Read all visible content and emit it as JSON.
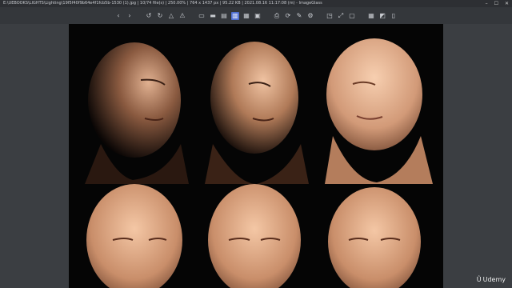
{
  "window": {
    "title": "E:\\UEBOOKS\\LIGHTS\\Lighting\\19f5f40f9b64e4f1fcb5b-1530 (1).jpg | 10/74 file(s) | 250.00% | 764 x 1437 px | 95.22 KB | 2021.08.16 11:17:08 (m) - ImageGlass"
  },
  "toolbar": {
    "buttons": [
      {
        "name": "back-icon",
        "glyph": "‹"
      },
      {
        "name": "forward-icon",
        "glyph": "›"
      },
      {
        "sep": true
      },
      {
        "name": "rotate-left-icon",
        "glyph": "↺"
      },
      {
        "name": "rotate-right-icon",
        "glyph": "↻"
      },
      {
        "name": "flip-icon",
        "glyph": "△"
      },
      {
        "name": "delete-icon",
        "glyph": "⚠"
      },
      {
        "sep": true
      },
      {
        "name": "auto-zoom-icon",
        "glyph": "▭"
      },
      {
        "name": "lock-zoom-icon",
        "glyph": "▬"
      },
      {
        "name": "scale-width-icon",
        "glyph": "▤"
      },
      {
        "name": "scale-height-icon",
        "glyph": "▥",
        "active": true
      },
      {
        "name": "scale-fill-icon",
        "glyph": "▦"
      },
      {
        "name": "scale-fit-icon",
        "glyph": "▣"
      },
      {
        "sep": true
      },
      {
        "name": "print-icon",
        "glyph": "⎙"
      },
      {
        "name": "refresh-icon",
        "glyph": "⟳"
      },
      {
        "name": "edit-icon",
        "glyph": "✎"
      },
      {
        "name": "settings-icon",
        "glyph": "⚙"
      },
      {
        "sep": true
      },
      {
        "name": "slideshow-icon",
        "glyph": "◳"
      },
      {
        "name": "fullscreen-icon",
        "glyph": "⤢"
      },
      {
        "name": "thumbnail-icon",
        "glyph": "▢"
      },
      {
        "sep": true
      },
      {
        "name": "gallery-icon",
        "glyph": "▦"
      },
      {
        "name": "info-icon",
        "glyph": "◩"
      },
      {
        "name": "trash-icon",
        "glyph": "▯"
      }
    ]
  },
  "watermark": {
    "text": "Udemy"
  }
}
